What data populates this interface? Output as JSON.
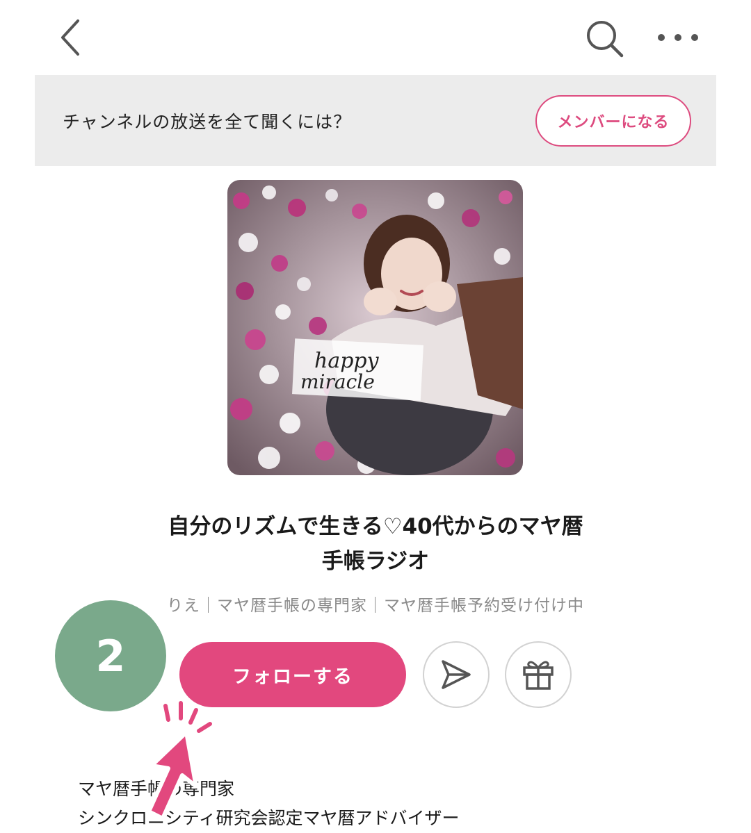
{
  "header": {
    "back_icon": "chevron-left-icon",
    "search_icon": "search-icon",
    "more_icon": "more-horizontal-icon"
  },
  "banner": {
    "text": "チャンネルの放送を全て聞くには？",
    "member_button": "メンバーになる"
  },
  "channel": {
    "cover_text_line1": "happy",
    "cover_text_line2": "miracle",
    "title_line1": "自分のリズムで生きる♡40代からのマヤ暦",
    "title_line2": "手帳ラジオ",
    "author": "りえ｜マヤ暦手帳の専門家｜マヤ暦手帳予約受け付け中"
  },
  "actions": {
    "follow_button": "フォローする",
    "share_icon": "send-icon",
    "gift_icon": "gift-icon"
  },
  "annotation": {
    "step_number": "2",
    "pointer_icon": "pointer-arrow-icon"
  },
  "description": {
    "line1": "マヤ暦手帳の専門家",
    "line2": "シンクロニシティ研究会認定マヤ暦アドバイザー"
  },
  "colors": {
    "accent": "#e2487e",
    "banner_bg": "#ececec",
    "step_badge": "#7aa98b"
  }
}
